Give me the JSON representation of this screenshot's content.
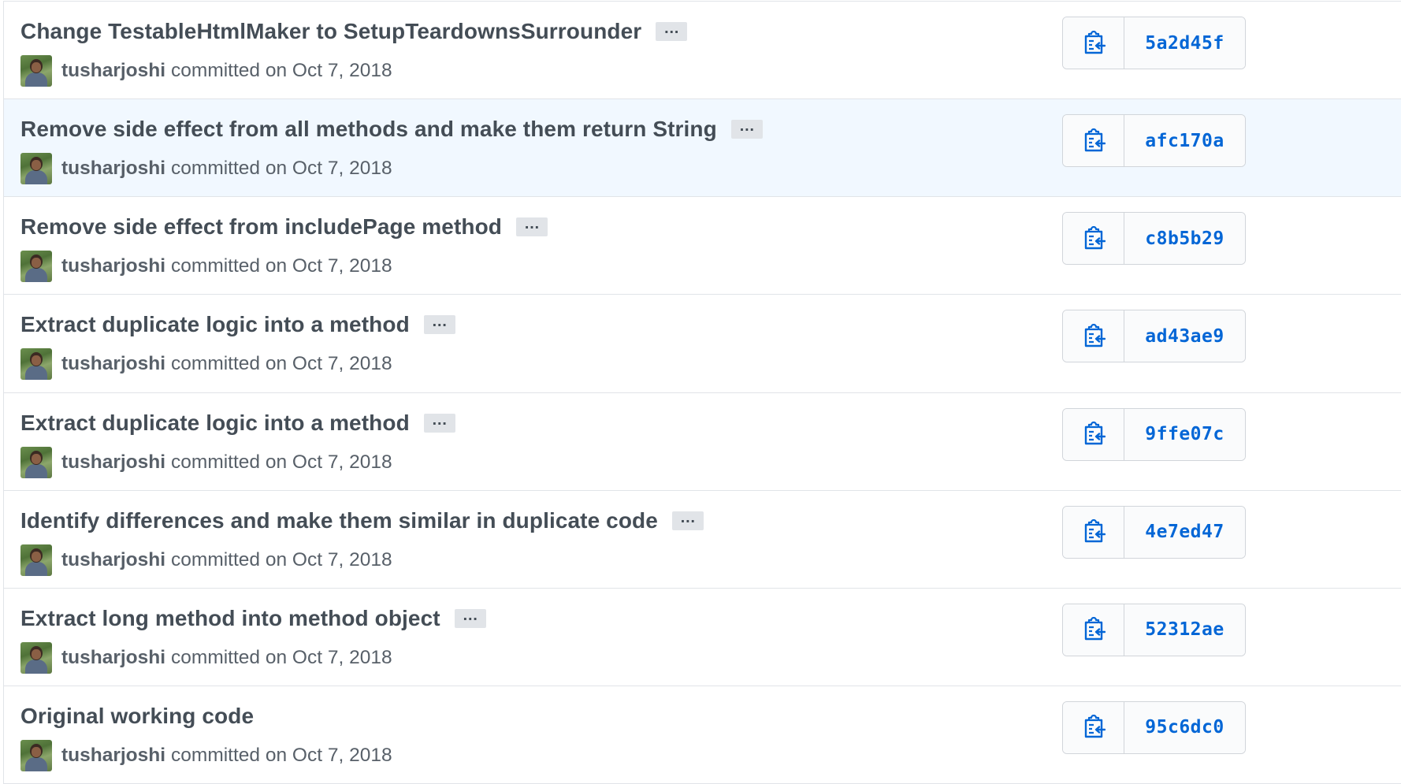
{
  "colors": {
    "title": "#444d56",
    "meta": "#586069",
    "sha": "#0366d6",
    "border": "#e1e4e8",
    "highlight_row": "#f1f8ff",
    "expander_bg": "#e1e4e8"
  },
  "icons": {
    "avatar": "user-avatar-photo",
    "copy": "clippy-copy-icon",
    "expander": "ellipsis-icon"
  },
  "commits": [
    {
      "title": "Change TestableHtmlMaker to SetupTeardownsSurrounder",
      "expander": "…",
      "author": "tusharjoshi",
      "committed": "committed on Oct 7, 2018",
      "sha": "5a2d45f",
      "highlighted": false
    },
    {
      "title": "Remove side effect from all methods and make them return String",
      "expander": "…",
      "author": "tusharjoshi",
      "committed": "committed on Oct 7, 2018",
      "sha": "afc170a",
      "highlighted": true
    },
    {
      "title": "Remove side effect from includePage method",
      "expander": "…",
      "author": "tusharjoshi",
      "committed": "committed on Oct 7, 2018",
      "sha": "c8b5b29",
      "highlighted": false
    },
    {
      "title": "Extract duplicate logic into a method",
      "expander": "…",
      "author": "tusharjoshi",
      "committed": "committed on Oct 7, 2018",
      "sha": "ad43ae9",
      "highlighted": false
    },
    {
      "title": "Extract duplicate logic into a method",
      "expander": "…",
      "author": "tusharjoshi",
      "committed": "committed on Oct 7, 2018",
      "sha": "9ffe07c",
      "highlighted": false
    },
    {
      "title": "Identify differences and make them similar in duplicate code",
      "expander": "…",
      "author": "tusharjoshi",
      "committed": "committed on Oct 7, 2018",
      "sha": "4e7ed47",
      "highlighted": false
    },
    {
      "title": "Extract long method into method object",
      "expander": "…",
      "author": "tusharjoshi",
      "committed": "committed on Oct 7, 2018",
      "sha": "52312ae",
      "highlighted": false
    },
    {
      "title": "Original working code",
      "author": "tusharjoshi",
      "committed": "committed on Oct 7, 2018",
      "sha": "95c6dc0",
      "highlighted": false
    }
  ]
}
